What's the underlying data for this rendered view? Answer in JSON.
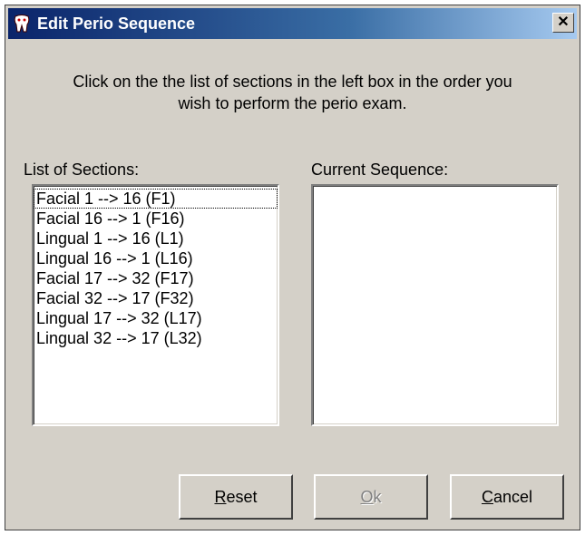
{
  "window": {
    "title": "Edit Perio Sequence",
    "close_label": "✕"
  },
  "instructions": "Click on the the list of sections in the left box in the order you\nwish to perform the perio exam.",
  "sections_label": "List of Sections:",
  "sequence_label": "Current Sequence:",
  "sections": [
    "Facial 1 --> 16 (F1)",
    "Facial 16 --> 1 (F16)",
    "Lingual 1 --> 16 (L1)",
    "Lingual 16 --> 1 (L16)",
    "Facial 17 --> 32 (F17)",
    "Facial 32 --> 17 (F32)",
    "Lingual 17 --> 32 (L17)",
    "Lingual 32 --> 17 (L32)"
  ],
  "current_sequence": [],
  "buttons": {
    "reset": {
      "mnemonic": "R",
      "rest": "eset"
    },
    "ok": {
      "mnemonic": "O",
      "rest": "k",
      "disabled": true
    },
    "cancel": {
      "mnemonic": "C",
      "rest": "ancel"
    }
  }
}
